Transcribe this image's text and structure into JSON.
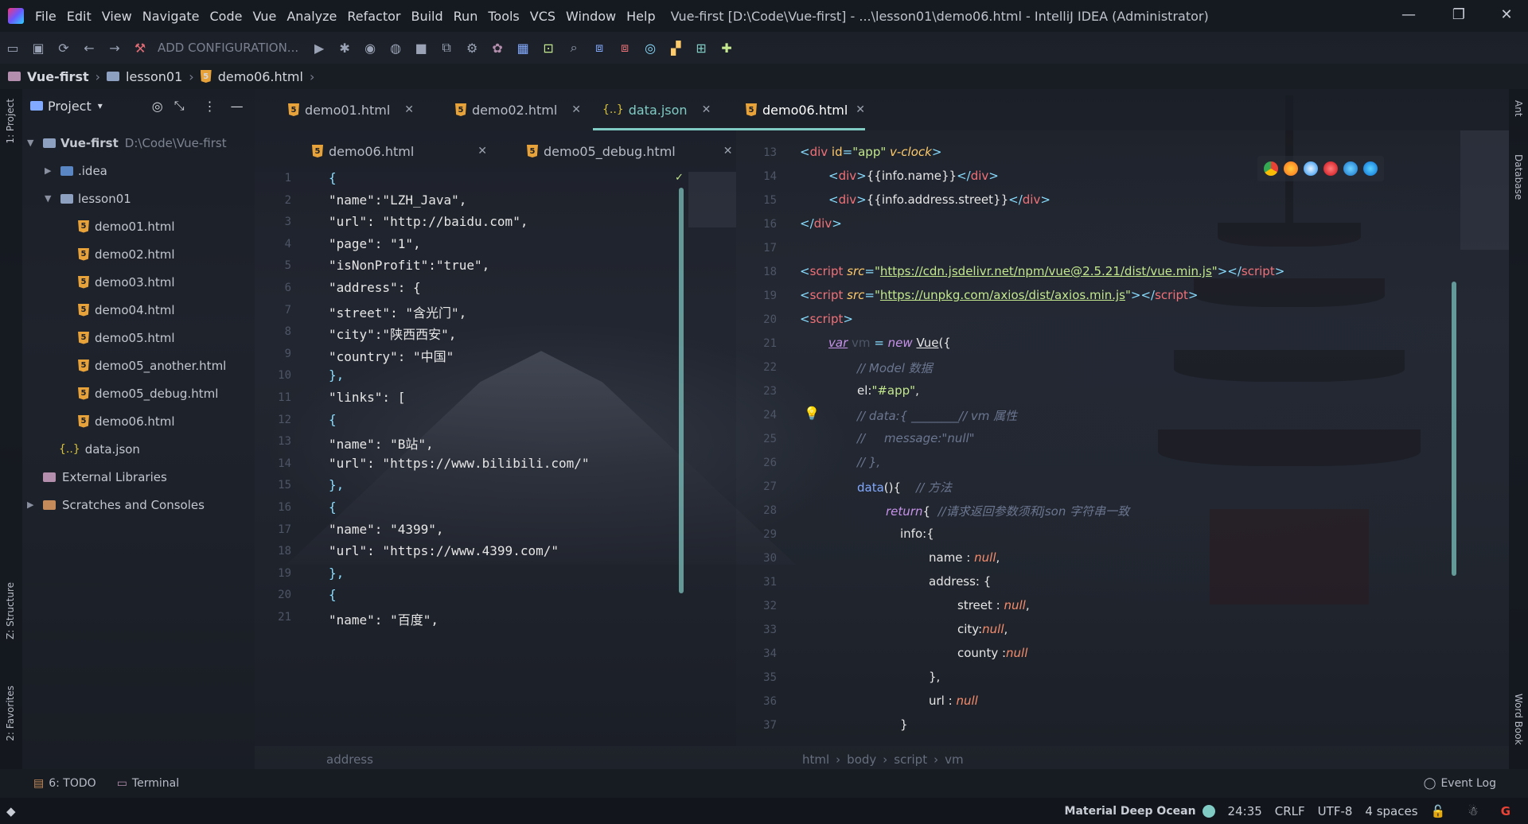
{
  "menubar": {
    "items": [
      "File",
      "Edit",
      "View",
      "Navigate",
      "Code",
      "Vue",
      "Analyze",
      "Refactor",
      "Build",
      "Run",
      "Tools",
      "VCS",
      "Window",
      "Help"
    ],
    "title": "Vue-first [D:\\Code\\Vue-first] - ...\\lesson01\\demo06.html - IntelliJ IDEA (Administrator)"
  },
  "toolbar": {
    "config_label": "ADD CONFIGURATION..."
  },
  "breadcrumb": {
    "items": [
      "Vue-first",
      "lesson01",
      "demo06.html"
    ]
  },
  "stripes": {
    "left_top": "1: Project",
    "left_structure": "Z: Structure",
    "left_favorites": "2: Favorites",
    "right_ant": "Ant",
    "right_database": "Database",
    "right_wordbook": "Word Book"
  },
  "project": {
    "header": "Project",
    "root_name": "Vue-first",
    "root_path": "D:\\Code\\Vue-first",
    "idea": ".idea",
    "lesson": "lesson01",
    "files": [
      "demo01.html",
      "demo02.html",
      "demo03.html",
      "demo04.html",
      "demo05.html",
      "demo05_another.html",
      "demo05_debug.html",
      "demo06.html"
    ],
    "json_file": "data.json",
    "external": "External Libraries",
    "scratches": "Scratches and Consoles"
  },
  "editor_left": {
    "tabs_row1": [
      "demo01.html",
      "demo02.html",
      "data.json"
    ],
    "tabs_row2": [
      "demo06.html",
      "demo05_debug.html"
    ],
    "numbers": [
      "1",
      "2",
      "3",
      "4",
      "5",
      "6",
      "7",
      "8",
      "9",
      "10",
      "11",
      "12",
      "13",
      "14",
      "15",
      "16",
      "17",
      "18",
      "19",
      "20",
      "21"
    ],
    "lines": [
      "{",
      "\"name\":\"LZH_Java\",",
      "\"url\": \"http://baidu.com\",",
      "\"page\": \"1\",",
      "\"isNonProfit\":\"true\",",
      "\"address\": {",
      "\"street\": \"含光门\",",
      "\"city\":\"陕西西安\",",
      "\"country\": \"中国\"",
      "},",
      "\"links\": [",
      "{",
      "\"name\": \"B站\",",
      "\"url\": \"https://www.bilibili.com/\"",
      "},",
      "{",
      "\"name\": \"4399\",",
      "\"url\": \"https://www.4399.com/\"",
      "},",
      "{",
      "\"name\": \"百度\","
    ],
    "crumb": "address"
  },
  "editor_right": {
    "tab": "demo06.html",
    "numbers": [
      "13",
      "14",
      "15",
      "16",
      "17",
      "18",
      "19",
      "20",
      "21",
      "22",
      "23",
      "24",
      "25",
      "26",
      "27",
      "28",
      "29",
      "30",
      "31",
      "32",
      "33",
      "34",
      "35",
      "36",
      "37"
    ],
    "crumbs": [
      "html",
      "body",
      "script",
      "vm"
    ]
  },
  "bottom": {
    "todo": "6: TODO",
    "terminal": "Terminal",
    "eventlog": "Event Log"
  },
  "status": {
    "theme": "Material Deep Ocean",
    "position": "24:35",
    "line_sep": "CRLF",
    "encoding": "UTF-8",
    "indent": "4 spaces"
  }
}
